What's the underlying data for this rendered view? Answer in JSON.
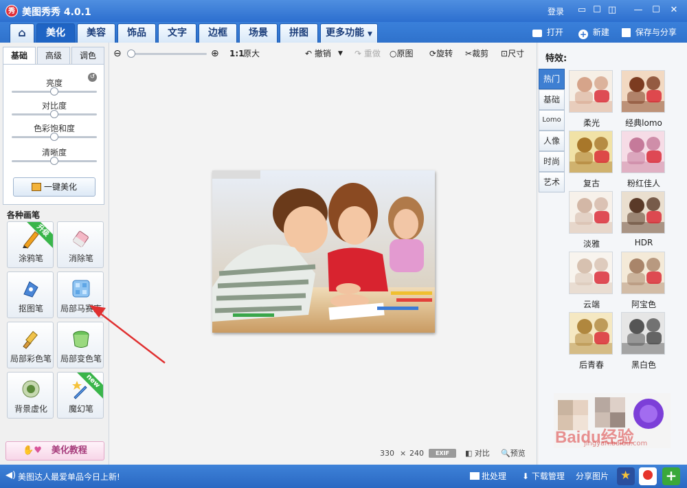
{
  "window": {
    "title": "美图秀秀 4.0.1",
    "logo_text": "秀",
    "login_label": "登录"
  },
  "main_tabs": [
    "美化",
    "美容",
    "饰品",
    "文字",
    "边框",
    "场景",
    "拼图",
    "更多功能"
  ],
  "top_actions": {
    "open": "打开",
    "new": "新建",
    "save_share": "保存与分享"
  },
  "left_panel": {
    "subtabs": [
      "基础",
      "高级",
      "调色"
    ],
    "sliders": [
      {
        "label": "亮度",
        "level": 0.5
      },
      {
        "label": "对比度",
        "level": 0.5
      },
      {
        "label": "色彩饱和度",
        "level": 0.5
      },
      {
        "label": "清晰度",
        "level": 0.5
      }
    ],
    "one_key": "一键美化",
    "brush_section_title": "各种画笔",
    "brushes": [
      {
        "label": "涂鸦笔",
        "badge": "升级"
      },
      {
        "label": "消除笔",
        "badge": ""
      },
      {
        "label": "抠图笔",
        "badge": ""
      },
      {
        "label": "局部马赛克",
        "badge": ""
      },
      {
        "label": "局部彩色笔",
        "badge": ""
      },
      {
        "label": "局部变色笔",
        "badge": ""
      },
      {
        "label": "背景虚化",
        "badge": ""
      },
      {
        "label": "魔幻笔",
        "badge": "new"
      }
    ],
    "tutorial": "美化教程"
  },
  "canvas_toolbar": {
    "ratio": "1:1",
    "original_size": "原大",
    "undo": "撤销",
    "redo": "重做",
    "original": "原图",
    "rotate": "旋转",
    "crop": "裁剪",
    "size": "尺寸"
  },
  "canvas_footer": {
    "width": "330",
    "times": "×",
    "height": "240",
    "exif": "EXIF",
    "compare": "对比",
    "preview": "预览"
  },
  "right_panel": {
    "title": "特效:",
    "categories": [
      "热门",
      "基础",
      "Lomo",
      "人像",
      "时尚",
      "艺术"
    ],
    "effects": [
      {
        "label": "柔光",
        "tone": "soft"
      },
      {
        "label": "经典lomo",
        "tone": "lomo"
      },
      {
        "label": "复古",
        "tone": "vintage"
      },
      {
        "label": "粉红佳人",
        "tone": "pink"
      },
      {
        "label": "淡雅",
        "tone": "pale"
      },
      {
        "label": "HDR",
        "tone": "hdr"
      },
      {
        "label": "云端",
        "tone": "cloud"
      },
      {
        "label": "阿宝色",
        "tone": "abao"
      },
      {
        "label": "后青春",
        "tone": "youth"
      },
      {
        "label": "黑白色",
        "tone": "bw"
      }
    ],
    "watermark": "Baidu经验",
    "watermark_url": "jingyan.baidu.com"
  },
  "status_bar": {
    "message": "美图达人最爱单品今日上新!",
    "batch": "批处理",
    "download": "下载管理",
    "share_pic": "分享图片"
  },
  "colors": {
    "accent": "#2c6fcf",
    "annotation_arrow": "#e03030",
    "active_tab": "#1f64c4"
  }
}
